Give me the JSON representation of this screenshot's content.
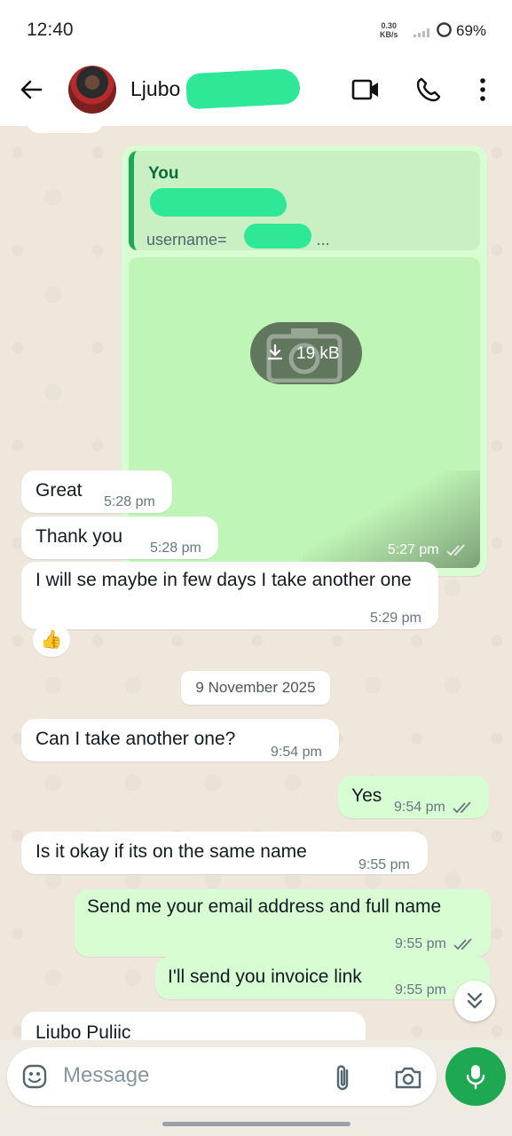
{
  "status_bar": {
    "time": "12:40",
    "net_speed_top": "0.30",
    "net_speed_bottom": "KB/s",
    "battery": "69%"
  },
  "header": {
    "contact_name": "Ljubo",
    "back_icon": "arrow-left-icon",
    "video_icon": "video-camera-icon",
    "call_icon": "phone-icon",
    "menu_icon": "more-vertical-icon"
  },
  "media_message": {
    "quote_author": "You",
    "quote_text": "username=",
    "quote_ellipsis": "...",
    "download_size": "19 kB",
    "time": "5:27 pm"
  },
  "messages": [
    {
      "dir": "in",
      "text": "Great",
      "time": "5:28 pm"
    },
    {
      "dir": "in",
      "text": "Thank you",
      "time": "5:28 pm"
    },
    {
      "dir": "in",
      "text": "I will se maybe in few days I take another one",
      "time": "5:29 pm"
    },
    {
      "dir": "in",
      "text": "Can I take another one?",
      "time": "9:54 pm"
    },
    {
      "dir": "out",
      "text": "Yes",
      "time": "9:54 pm"
    },
    {
      "dir": "in",
      "text": "Is it okay if its on the same name",
      "time": "9:55 pm"
    },
    {
      "dir": "out",
      "text": "Send me your email address and full name",
      "time": "9:55 pm"
    },
    {
      "dir": "out",
      "text": "I'll send you invoice link",
      "time": "9:55 pm"
    },
    {
      "dir": "in",
      "text": "Liubo Puliic",
      "time": ""
    }
  ],
  "reaction": "👍",
  "date_divider": "9 November 2025",
  "composer": {
    "placeholder": "Message",
    "emoji_icon": "emoji-icon",
    "attach_icon": "paperclip-icon",
    "camera_icon": "camera-icon",
    "mic_icon": "microphone-icon"
  },
  "colors": {
    "outgoing_bubble": "#d9fdd3",
    "incoming_bubble": "#ffffff",
    "accent_green": "#1da851",
    "read_ticks": "#667781"
  }
}
